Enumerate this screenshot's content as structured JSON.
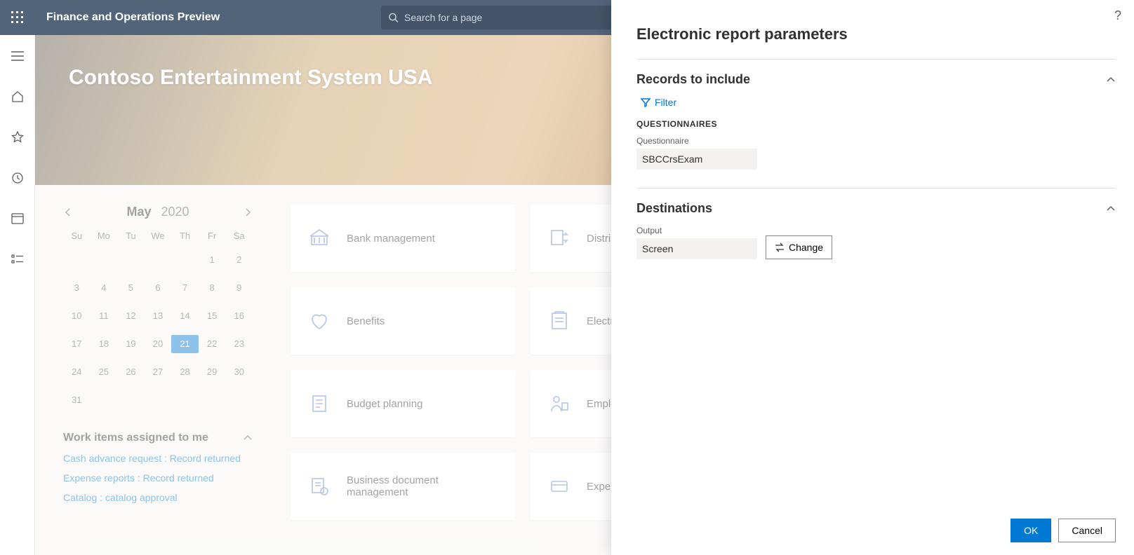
{
  "header": {
    "app_title": "Finance and Operations Preview",
    "search_placeholder": "Search for a page"
  },
  "hero": {
    "company": "Contoso Entertainment System USA"
  },
  "calendar": {
    "month": "May",
    "year": "2020",
    "dow": [
      "Su",
      "Mo",
      "Tu",
      "We",
      "Th",
      "Fr",
      "Sa"
    ],
    "weeks": [
      [
        "",
        "",
        "",
        "",
        "",
        "1",
        "2"
      ],
      [
        "3",
        "4",
        "5",
        "6",
        "7",
        "8",
        "9"
      ],
      [
        "10",
        "11",
        "12",
        "13",
        "14",
        "15",
        "16"
      ],
      [
        "17",
        "18",
        "19",
        "20",
        "21",
        "22",
        "23"
      ],
      [
        "24",
        "25",
        "26",
        "27",
        "28",
        "29",
        "30"
      ],
      [
        "31",
        "",
        "",
        "",
        "",
        "",
        ""
      ]
    ],
    "selected": "21"
  },
  "workitems": {
    "title": "Work items assigned to me",
    "items": [
      "Cash advance request : Record returned",
      "Expense reports : Record returned",
      "Catalog : catalog approval"
    ]
  },
  "tiles": [
    {
      "label": "Bank management",
      "icon": "bank"
    },
    {
      "label": "Distributed order management",
      "icon": "dom"
    },
    {
      "label": "Benefits",
      "icon": "benefits"
    },
    {
      "label": "Electronic reporting",
      "icon": "er"
    },
    {
      "label": "Budget planning",
      "icon": "budget"
    },
    {
      "label": "Employee self service",
      "icon": "ess"
    },
    {
      "label": "Business document management",
      "icon": "bdm"
    },
    {
      "label": "Expense management",
      "icon": "expense"
    }
  ],
  "panel": {
    "title": "Electronic report parameters",
    "records_section": "Records to include",
    "filter_label": "Filter",
    "questionnaires_heading": "QUESTIONNAIRES",
    "questionnaire_label": "Questionnaire",
    "questionnaire_value": "SBCCrsExam",
    "dest_section": "Destinations",
    "output_label": "Output",
    "output_value": "Screen",
    "change_label": "Change",
    "ok": "OK",
    "cancel": "Cancel"
  }
}
